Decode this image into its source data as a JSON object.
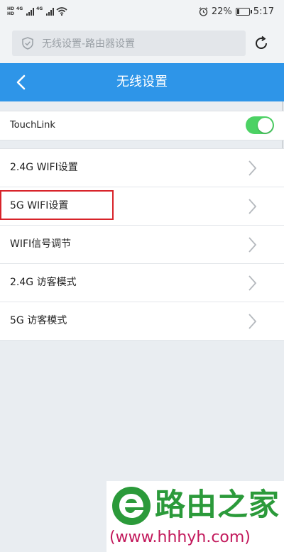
{
  "status_bar": {
    "hd_label_1": "HD",
    "hd_label_2": "HD",
    "net_1": "4G",
    "net_2": "4G",
    "battery_percent": "22%",
    "battery_level": 0.22,
    "time": "5:17"
  },
  "browser": {
    "url_text": "无线设置-路由器设置"
  },
  "header": {
    "title": "无线设置",
    "color": "#2e95e8"
  },
  "touchlink": {
    "label": "TouchLink",
    "enabled": true,
    "toggle_color": "#4cd264"
  },
  "menu": {
    "items": [
      {
        "label": "2.4G WIFI设置"
      },
      {
        "label": "5G WIFI设置"
      },
      {
        "label": "WIFI信号调节"
      },
      {
        "label": "2.4G 访客模式"
      },
      {
        "label": "5G 访客模式"
      }
    ],
    "highlighted_index": 1,
    "highlight_color": "#d8232a"
  },
  "watermark": {
    "brand": "路由之家",
    "url": "(www.hhhyh.com)"
  }
}
